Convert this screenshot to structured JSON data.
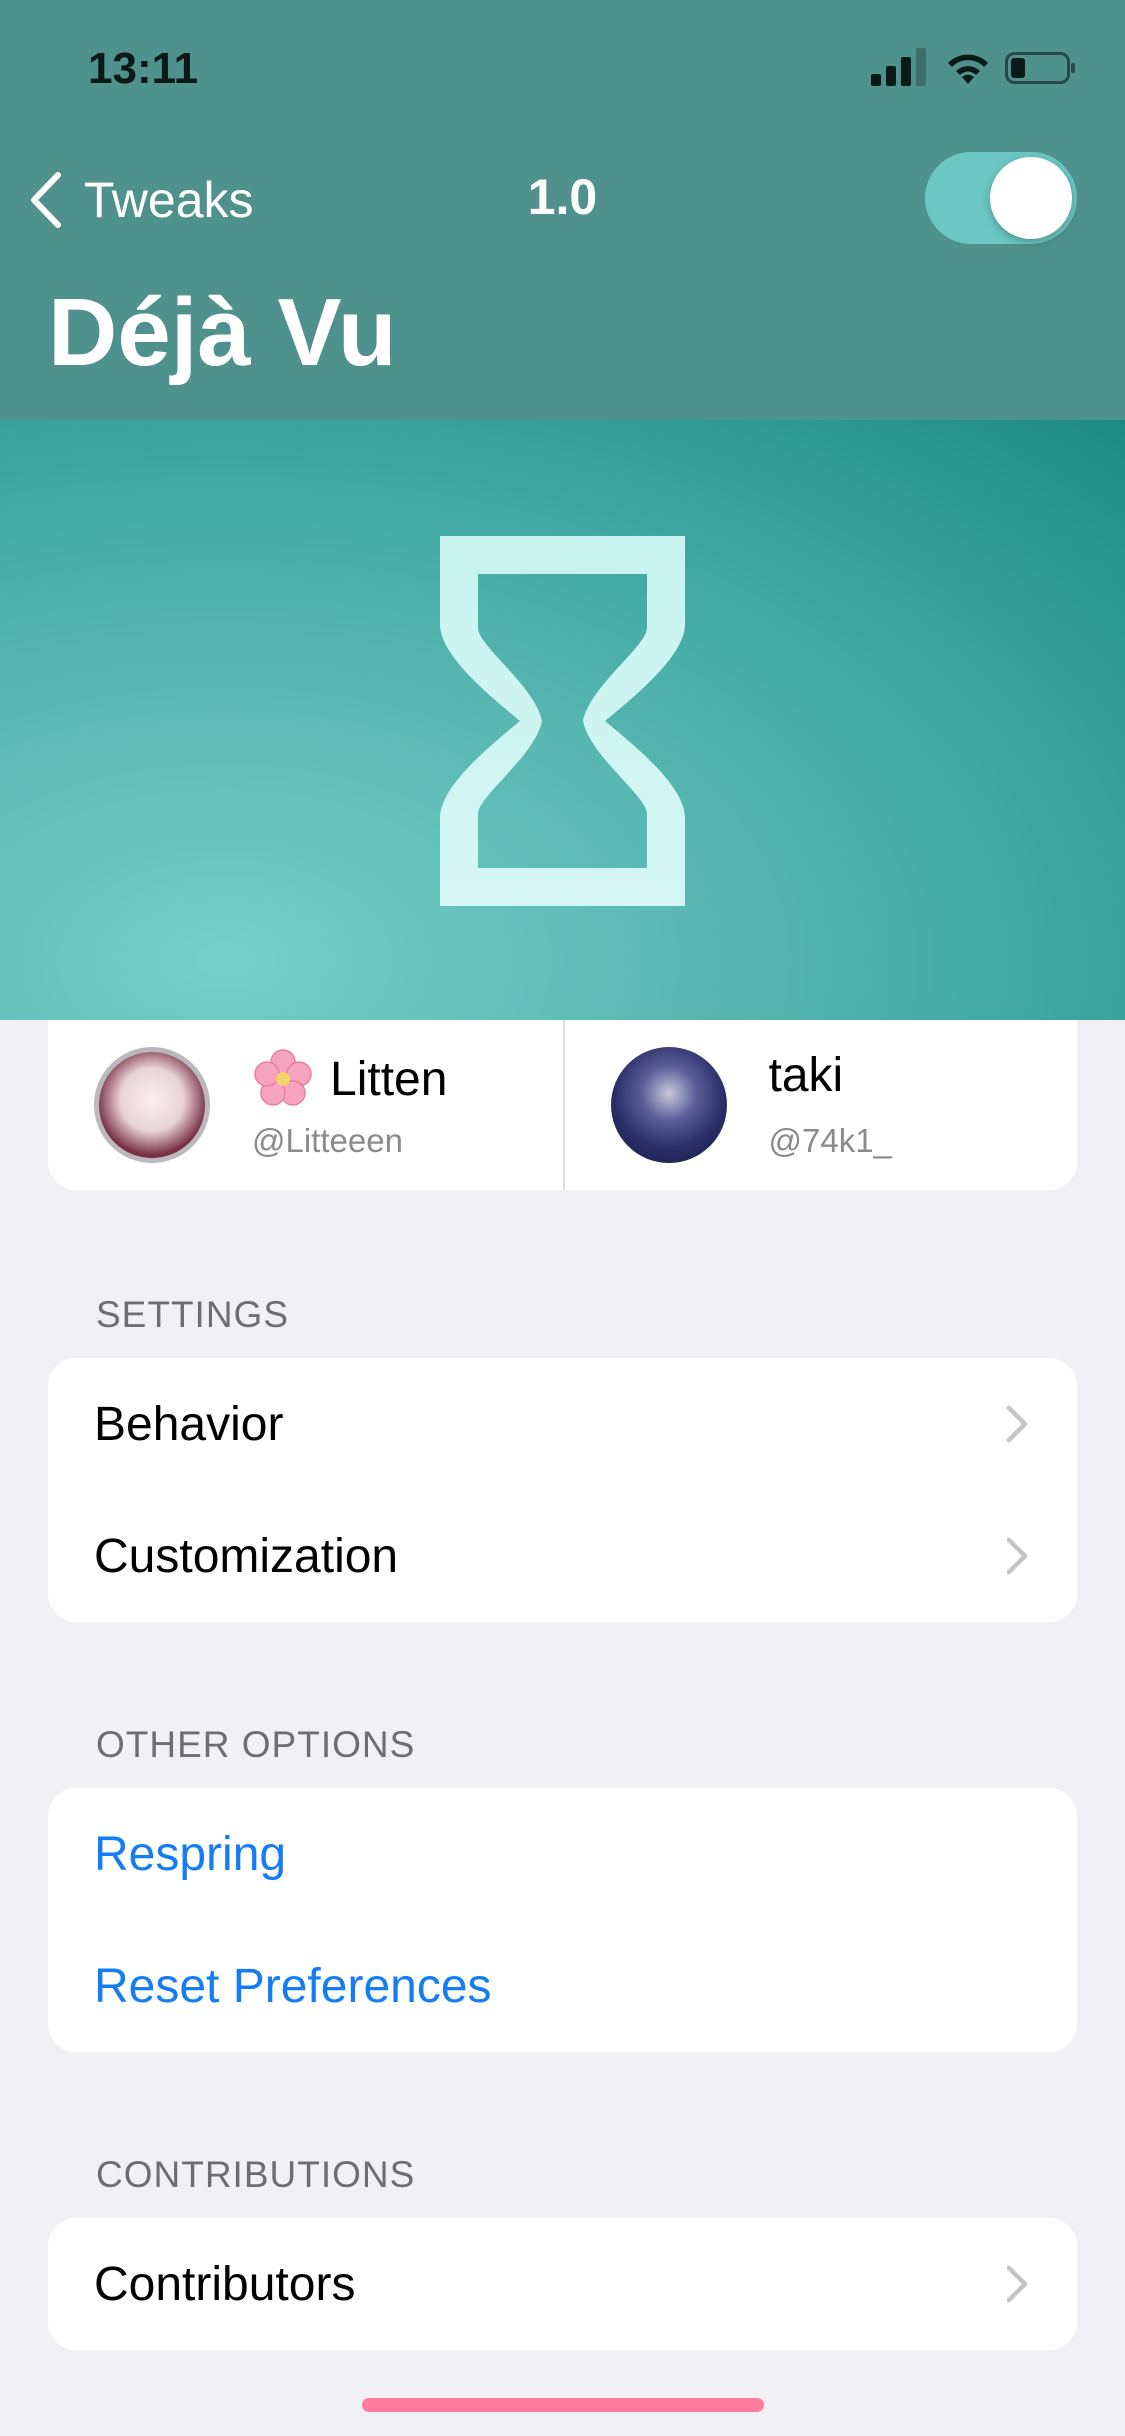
{
  "status_bar": {
    "time": "13:11",
    "icons": [
      "cellular-signal-icon",
      "wifi-icon",
      "battery-icon"
    ]
  },
  "nav": {
    "back_label": "Tweaks",
    "version": "1.0",
    "toggle_on": true
  },
  "title": "Déjà Vu",
  "banner": {
    "icon": "hourglass-icon"
  },
  "authors": [
    {
      "name": "Litten",
      "handle": "@Litteeen",
      "emoji": "cherry-blossom"
    },
    {
      "name": "taki",
      "handle": "@74k1_"
    }
  ],
  "sections": [
    {
      "header": "SETTINGS",
      "items": [
        {
          "label": "Behavior",
          "chevron": true
        },
        {
          "label": "Customization",
          "chevron": true
        }
      ]
    },
    {
      "header": "OTHER OPTIONS",
      "items": [
        {
          "label": "Respring",
          "style": "link"
        },
        {
          "label": "Reset Preferences",
          "style": "link"
        }
      ]
    },
    {
      "header": "CONTRIBUTIONS",
      "items": [
        {
          "label": "Contributors",
          "chevron": true
        }
      ]
    }
  ],
  "colors": {
    "header_bg": "#4f918c",
    "toggle_on": "#6cc6c2",
    "link_blue": "#147df4",
    "home_indicator": "#ff7ba0"
  }
}
